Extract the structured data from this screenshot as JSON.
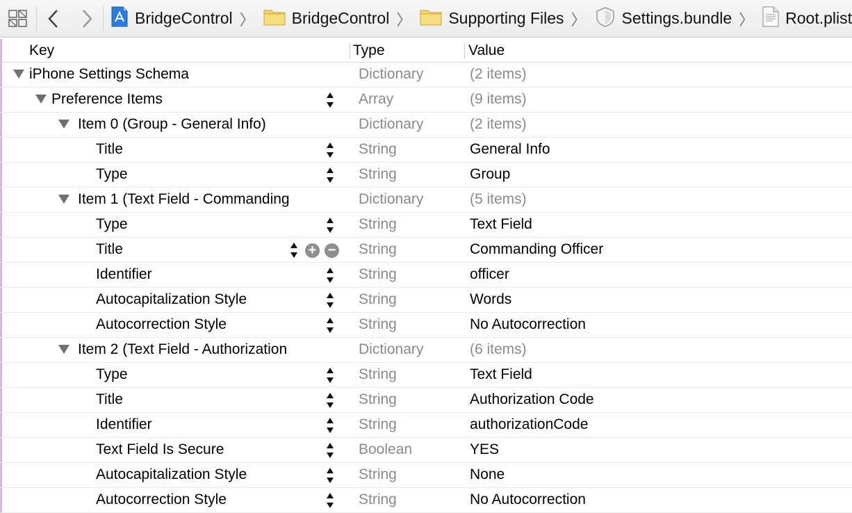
{
  "breadcrumbs": [
    {
      "label": "BridgeControl",
      "icon": "xcode-project-icon"
    },
    {
      "label": "BridgeControl",
      "icon": "folder-icon"
    },
    {
      "label": "Supporting Files",
      "icon": "folder-icon"
    },
    {
      "label": "Settings.bundle",
      "icon": "bundle-icon"
    },
    {
      "label": "Root.plist",
      "icon": "plist-file-icon"
    }
  ],
  "header": {
    "key": "Key",
    "type": "Type",
    "value": "Value"
  },
  "rows": [
    {
      "key": "iPhone Settings Schema",
      "type": "Dictionary",
      "value": "(2 items)",
      "level": 0,
      "expanded": true,
      "stepper": false,
      "dim": true
    },
    {
      "key": "Preference Items",
      "type": "Array",
      "value": "(9 items)",
      "level": 1,
      "expanded": true,
      "stepper": true,
      "dim": true
    },
    {
      "key": "Item 0 (Group - General Info)",
      "type": "Dictionary",
      "value": "(2 items)",
      "level": 2,
      "expanded": true,
      "stepper": false,
      "dim": true
    },
    {
      "key": "Title",
      "type": "String",
      "value": "General Info",
      "level": 3,
      "stepper": true
    },
    {
      "key": "Type",
      "type": "String",
      "value": "Group",
      "level": 3,
      "stepper": true
    },
    {
      "key": "Item 1 (Text Field - Commanding",
      "type": "Dictionary",
      "value": "(5 items)",
      "level": 2,
      "expanded": true,
      "stepper": false,
      "dim": true
    },
    {
      "key": "Type",
      "type": "String",
      "value": "Text Field",
      "level": 3,
      "stepper": true
    },
    {
      "key": "Title",
      "type": "String",
      "value": "Commanding Officer",
      "level": 3,
      "stepper": true,
      "hover": true
    },
    {
      "key": "Identifier",
      "type": "String",
      "value": "officer",
      "level": 3,
      "stepper": true
    },
    {
      "key": "Autocapitalization Style",
      "type": "String",
      "value": "Words",
      "level": 3,
      "stepper": true
    },
    {
      "key": "Autocorrection Style",
      "type": "String",
      "value": "No Autocorrection",
      "level": 3,
      "stepper": true
    },
    {
      "key": "Item 2 (Text Field - Authorization",
      "type": "Dictionary",
      "value": "(6 items)",
      "level": 2,
      "expanded": true,
      "stepper": false,
      "dim": true
    },
    {
      "key": "Type",
      "type": "String",
      "value": "Text Field",
      "level": 3,
      "stepper": true
    },
    {
      "key": "Title",
      "type": "String",
      "value": "Authorization Code",
      "level": 3,
      "stepper": true
    },
    {
      "key": "Identifier",
      "type": "String",
      "value": "authorizationCode",
      "level": 3,
      "stepper": true
    },
    {
      "key": "Text Field Is Secure",
      "type": "Boolean",
      "value": "YES",
      "level": 3,
      "stepper": true
    },
    {
      "key": "Autocapitalization Style",
      "type": "String",
      "value": "None",
      "level": 3,
      "stepper": true
    },
    {
      "key": "Autocorrection Style",
      "type": "String",
      "value": "No Autocorrection",
      "level": 3,
      "stepper": true
    }
  ],
  "colors": {
    "dim_text": "#8a8a8a",
    "folder": "#f3d36b",
    "xcode_blue": "#2f7bd9",
    "left_border": "#d7b6df"
  }
}
